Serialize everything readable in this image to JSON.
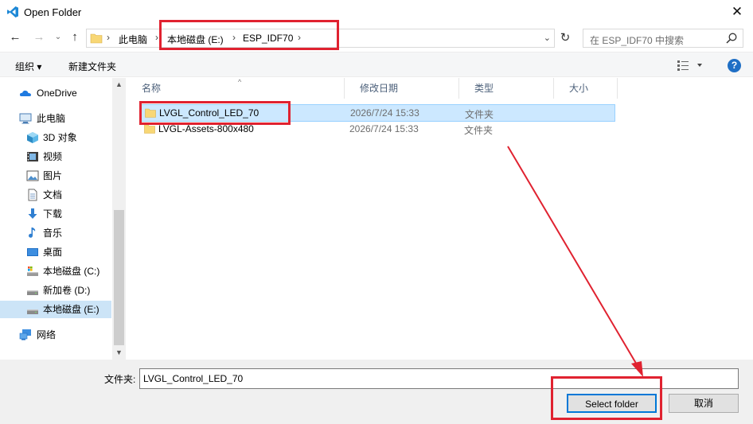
{
  "window": {
    "title": "Open Folder",
    "close_glyph": "✕"
  },
  "nav": {
    "back_glyph": "←",
    "forward_glyph": "→",
    "recent_glyph": "⌄",
    "up_glyph": "↑",
    "refresh_glyph": "↻",
    "sep": "›",
    "breadcrumbs": [
      "此电脑",
      "本地磁盘 (E:)",
      "ESP_IDF70"
    ],
    "dropdown_glyph": "⌄",
    "search_placeholder": "在 ESP_IDF70 中搜索"
  },
  "toolbar": {
    "organize_label": "组织 ▾",
    "new_folder_label": "新建文件夹",
    "view_icon": "view-options-icon",
    "help_glyph": "?"
  },
  "sidebar": {
    "items": [
      {
        "label": "OneDrive",
        "icon": "onedrive-icon"
      },
      {
        "label": "此电脑",
        "icon": "computer-icon"
      },
      {
        "label": "3D 对象",
        "icon": "3d-objects-icon"
      },
      {
        "label": "视频",
        "icon": "video-icon"
      },
      {
        "label": "图片",
        "icon": "pictures-icon"
      },
      {
        "label": "文档",
        "icon": "documents-icon"
      },
      {
        "label": "下载",
        "icon": "downloads-icon"
      },
      {
        "label": "音乐",
        "icon": "music-icon"
      },
      {
        "label": "桌面",
        "icon": "desktop-icon"
      },
      {
        "label": "本地磁盘 (C:)",
        "icon": "drive-c-icon"
      },
      {
        "label": "新加卷 (D:)",
        "icon": "drive-d-icon"
      },
      {
        "label": "本地磁盘 (E:)",
        "icon": "drive-e-icon",
        "selected": true
      },
      {
        "label": "网络",
        "icon": "network-icon"
      }
    ],
    "scroll_up_glyph": "▲",
    "scroll_down_glyph": "▼"
  },
  "columns": [
    {
      "label": "名称"
    },
    {
      "label": "修改日期"
    },
    {
      "label": "类型"
    },
    {
      "label": "大小"
    }
  ],
  "sort_glyph": "^",
  "files": [
    {
      "name": "LVGL_Control_LED_70",
      "date": "2026/7/24 15:33",
      "type": "文件夹",
      "selected": true
    },
    {
      "name": "LVGL-Assets-800x480",
      "date": "2026/7/24 15:33",
      "type": "文件夹",
      "selected": false
    }
  ],
  "bottom": {
    "filename_label": "文件夹:",
    "filename_value": "LVGL_Control_LED_70",
    "select_label": "Select folder",
    "cancel_label": "取消"
  },
  "colors": {
    "accent": "#0078d7",
    "selection": "#cce8ff",
    "annotation": "#e02230",
    "folder": "#f8d775"
  }
}
